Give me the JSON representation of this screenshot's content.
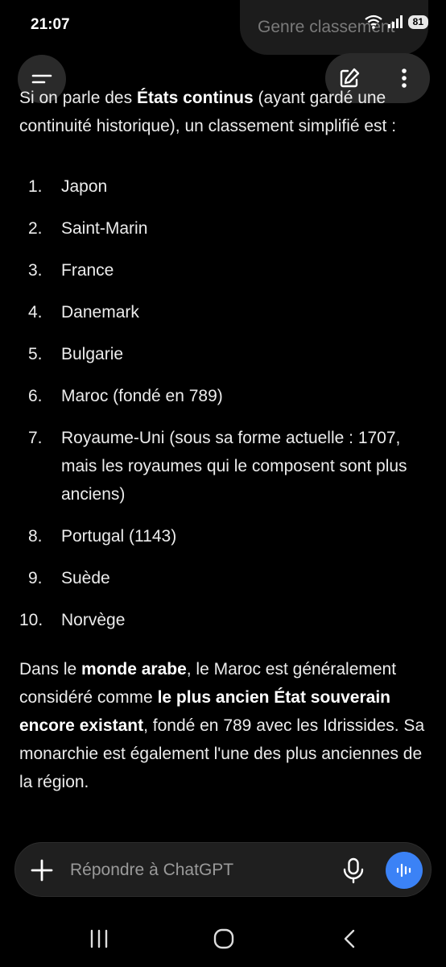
{
  "status": {
    "time": "21:07",
    "battery": "81",
    "icons": [
      "wifi-icon",
      "signal-icon",
      "battery-icon"
    ]
  },
  "header": {
    "chat_title": "Genre classement",
    "menu_icon": "menu-icon",
    "edit_icon": "new-chat-icon",
    "more_icon": "more-vertical-icon"
  },
  "message": {
    "intro_pre": "Si on parle des ",
    "intro_bold": "États continus",
    "intro_post": " (ayant gardé une continuité historique), un classement simplifié est :",
    "list": [
      {
        "num": "1.",
        "text": "Japon"
      },
      {
        "num": "2.",
        "text": "Saint-Marin"
      },
      {
        "num": "3.",
        "text": "France"
      },
      {
        "num": "4.",
        "text": "Danemark"
      },
      {
        "num": "5.",
        "text": "Bulgarie"
      },
      {
        "num": "6.",
        "text": "Maroc (fondé en 789)"
      },
      {
        "num": "7.",
        "text": "Royaume-Uni (sous sa forme actuelle : 1707, mais les royaumes qui le composent sont plus anciens)"
      },
      {
        "num": "8.",
        "text": "Portugal (1143)"
      },
      {
        "num": "9.",
        "text": "Suède"
      },
      {
        "num": "10.",
        "text": "Norvège"
      }
    ],
    "outro_1": "Dans le ",
    "outro_bold_1": "monde arabe",
    "outro_2": ", le Maroc est généralement considéré comme ",
    "outro_bold_2": "le plus ancien État souverain encore existant",
    "outro_3": ", fondé en 789 avec les Idrissides. Sa monarchie est également l'une des plus anciennes de la région."
  },
  "composer": {
    "placeholder": "Répondre à ChatGPT",
    "plus_icon": "plus-icon",
    "mic_icon": "microphone-icon",
    "voice_icon": "voice-mode-icon",
    "voice_color": "#3b82f6"
  },
  "navigation": {
    "recents_icon": "recents-icon",
    "home_icon": "home-icon",
    "back_icon": "back-icon"
  }
}
